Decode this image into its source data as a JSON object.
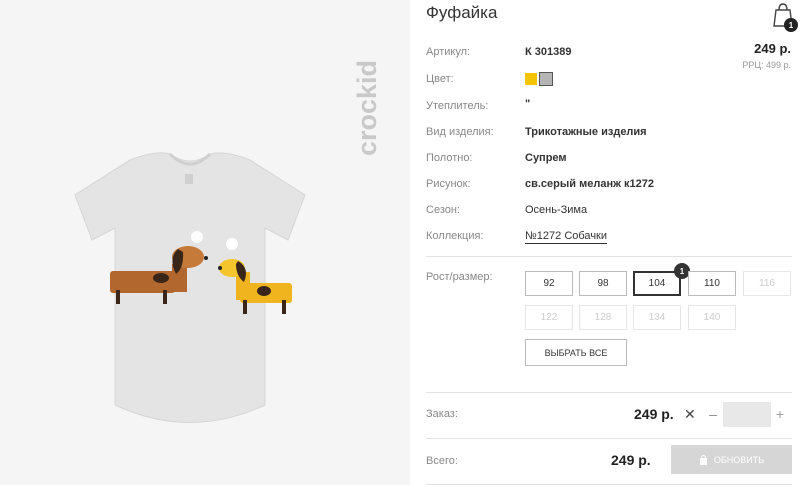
{
  "brand": {
    "logo_text": "crockid"
  },
  "product": {
    "title": "Фуфайка",
    "fields": [
      {
        "label": "Артикул:",
        "value": "К 301389"
      },
      {
        "label": "Цвет:",
        "value": ""
      },
      {
        "label": "Утеплитель:",
        "value": "\""
      },
      {
        "label": "Вид изделия:",
        "value": "Трикотажные изделия"
      },
      {
        "label": "Полотно:",
        "value": "Супрем"
      },
      {
        "label": "Рисунок:",
        "value": "св.серый меланж к1272"
      },
      {
        "label": "Сезон:",
        "value": "Осень-Зима"
      },
      {
        "label": "Коллекция:",
        "value": "№1272 Собачки"
      }
    ],
    "colors": [
      "#f5c400",
      "#b5b5b5"
    ],
    "price": "249 р.",
    "rrp": "РРЦ: 499 р."
  },
  "cart": {
    "count": "1"
  },
  "sizes": {
    "label": "Рост/размер:",
    "items": [
      {
        "value": "92",
        "state": "available"
      },
      {
        "value": "98",
        "state": "available"
      },
      {
        "value": "104",
        "state": "selected",
        "badge": "1"
      },
      {
        "value": "110",
        "state": "available"
      },
      {
        "value": "116",
        "state": "disabled"
      },
      {
        "value": "122",
        "state": "disabled"
      },
      {
        "value": "128",
        "state": "disabled"
      },
      {
        "value": "134",
        "state": "disabled"
      },
      {
        "value": "140",
        "state": "disabled"
      }
    ],
    "select_all_label": "ВЫБРАТЬ ВСЕ"
  },
  "order": {
    "label": "Заказ:",
    "price": "249 р.",
    "remove_symbol": "✕",
    "minus": "–",
    "plus": "+",
    "quantity": ""
  },
  "total": {
    "label": "Всего:",
    "price": "249 р.",
    "update_label": "ОБНОВИТЬ"
  }
}
